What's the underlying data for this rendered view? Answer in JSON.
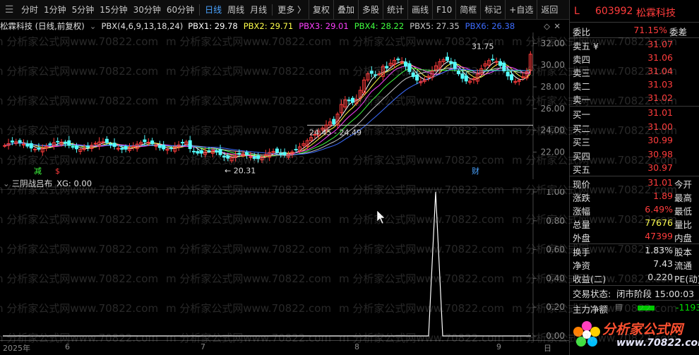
{
  "toolbar": {
    "items": [
      "分时",
      "1分钟",
      "5分钟",
      "15分钟",
      "30分钟",
      "60分钟",
      "日线",
      "周线",
      "月线",
      "更多 〉",
      "复权",
      "叠加",
      "多股",
      "统计",
      "画线",
      "F10",
      "简框",
      "标记",
      "+自选",
      "返回"
    ],
    "active": "日线"
  },
  "info": {
    "title": "松霖科技 (日线,前复权)",
    "indicator": "PBX(4,6,9,13,18,24)",
    "pbx": [
      {
        "label": "PBX1: 29.78",
        "color": "#ffffff"
      },
      {
        "label": "PBX2: 29.71",
        "color": "#ffff4a"
      },
      {
        "label": "PBX3: 29.01",
        "color": "#ff40ff"
      },
      {
        "label": "PBX4: 28.22",
        "color": "#40ff40"
      },
      {
        "label": "PBX5: 27.35",
        "color": "#c8c8c8"
      },
      {
        "label": "PBX6: 26.38",
        "color": "#3c6cff"
      }
    ]
  },
  "main_axis": [
    "32.00",
    "30.00",
    "28.00",
    "26.00",
    "24.00",
    "22.00"
  ],
  "annotations": {
    "high": "31.75",
    "mid": "24.45 - 24.49",
    "low": "← 20.31",
    "mark_jian": "减",
    "mark_s": "$",
    "mark_cai": "财"
  },
  "sub": {
    "title": "三阴战吕布",
    "xg": "XG: 0.00",
    "axis": [
      "1.00",
      "0.80",
      "0.60",
      "0.40",
      "0.20",
      "0.00"
    ]
  },
  "xaxis": {
    "labels": [
      "2025年",
      "6",
      "7",
      "8",
      "9",
      "日"
    ]
  },
  "panel": {
    "code": "603992",
    "name": "松霖科技",
    "L": "L",
    "weibi": {
      "label": "委比",
      "value": "71.15%",
      "label2": "委差"
    },
    "sell": [
      {
        "label": "卖五 ¥",
        "price": "31.07"
      },
      {
        "label": "卖四",
        "price": "31.06"
      },
      {
        "label": "卖三",
        "price": "31.04"
      },
      {
        "label": "卖二",
        "price": "31.03"
      },
      {
        "label": "卖一",
        "price": "31.02"
      }
    ],
    "buy": [
      {
        "label": "买一",
        "price": "31.01"
      },
      {
        "label": "买二",
        "price": "31.00"
      },
      {
        "label": "买三",
        "price": "30.99"
      },
      {
        "label": "买四",
        "price": "30.98"
      },
      {
        "label": "买五",
        "price": "30.97"
      }
    ],
    "stats": [
      {
        "l": "现价",
        "v": "31.01",
        "c": "red",
        "r": "今开"
      },
      {
        "l": "涨跌",
        "v": "1.89",
        "c": "red",
        "r": "最高"
      },
      {
        "l": "涨幅",
        "v": "6.49%",
        "c": "red",
        "r": "最低"
      },
      {
        "l": "总量",
        "v": "77676",
        "c": "yel",
        "r": "量比"
      },
      {
        "l": "外盘",
        "v": "47399",
        "c": "red",
        "r": "内盘"
      }
    ],
    "stats2": [
      {
        "l": "换手",
        "v": "1.83%",
        "r": "股本"
      },
      {
        "l": "净资",
        "v": "7.43",
        "r": "流通"
      },
      {
        "l": "收益(二)",
        "v": "0.220",
        "r": "PE(动)"
      }
    ],
    "status": {
      "label": "交易状态:",
      "value": "闭市阶段 15:00:03"
    },
    "flow": {
      "label": "主力净额",
      "value": "-1193"
    },
    "logo": {
      "text": "分析家公式网",
      "url": "www.70822.com"
    }
  },
  "watermark": "m 分析家公式网www.70822.com",
  "chart_data": {
    "type": "candlestick",
    "ylim": [
      19.5,
      33
    ],
    "last_close": 31.01,
    "high": 31.75,
    "low": 20.31,
    "sub_type": "line",
    "sub_ylim": [
      0,
      1
    ],
    "signal_value": 1.0
  }
}
